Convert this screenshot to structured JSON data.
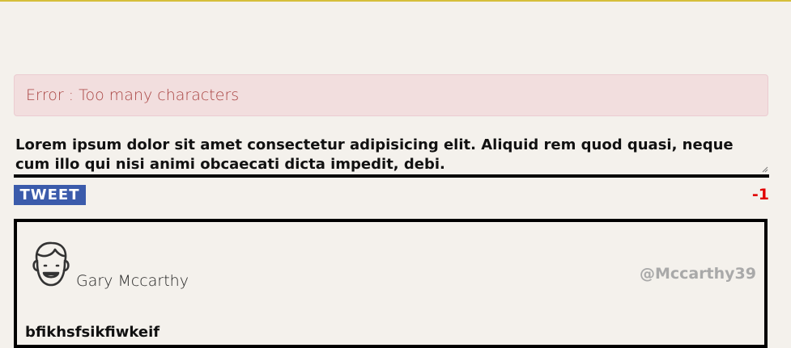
{
  "error": {
    "message": "Error : Too many characters"
  },
  "composer": {
    "text": "Lorem ipsum dolor sit amet consectetur adipisicing elit. Aliquid rem quod quasi, neque cum illo qui nisi animi obcaecati dicta impedit, debi."
  },
  "actions": {
    "tweet_label": "TWEET",
    "char_counter": "-1"
  },
  "tweet": {
    "author_name": "Gary Mccarthy",
    "handle": "@Mccarthy39",
    "content": "bfikhsfsikfiwkeif",
    "avatar_icon": "smiling-boy-avatar-icon"
  },
  "colors": {
    "background": "#f4f1ec",
    "accent_top": "#d6bf3a",
    "error_bg": "#f2dede",
    "error_text": "#a94442",
    "tweet_button": "#3b5bab",
    "counter_negative": "#e10000",
    "handle": "#a9a9a9"
  }
}
